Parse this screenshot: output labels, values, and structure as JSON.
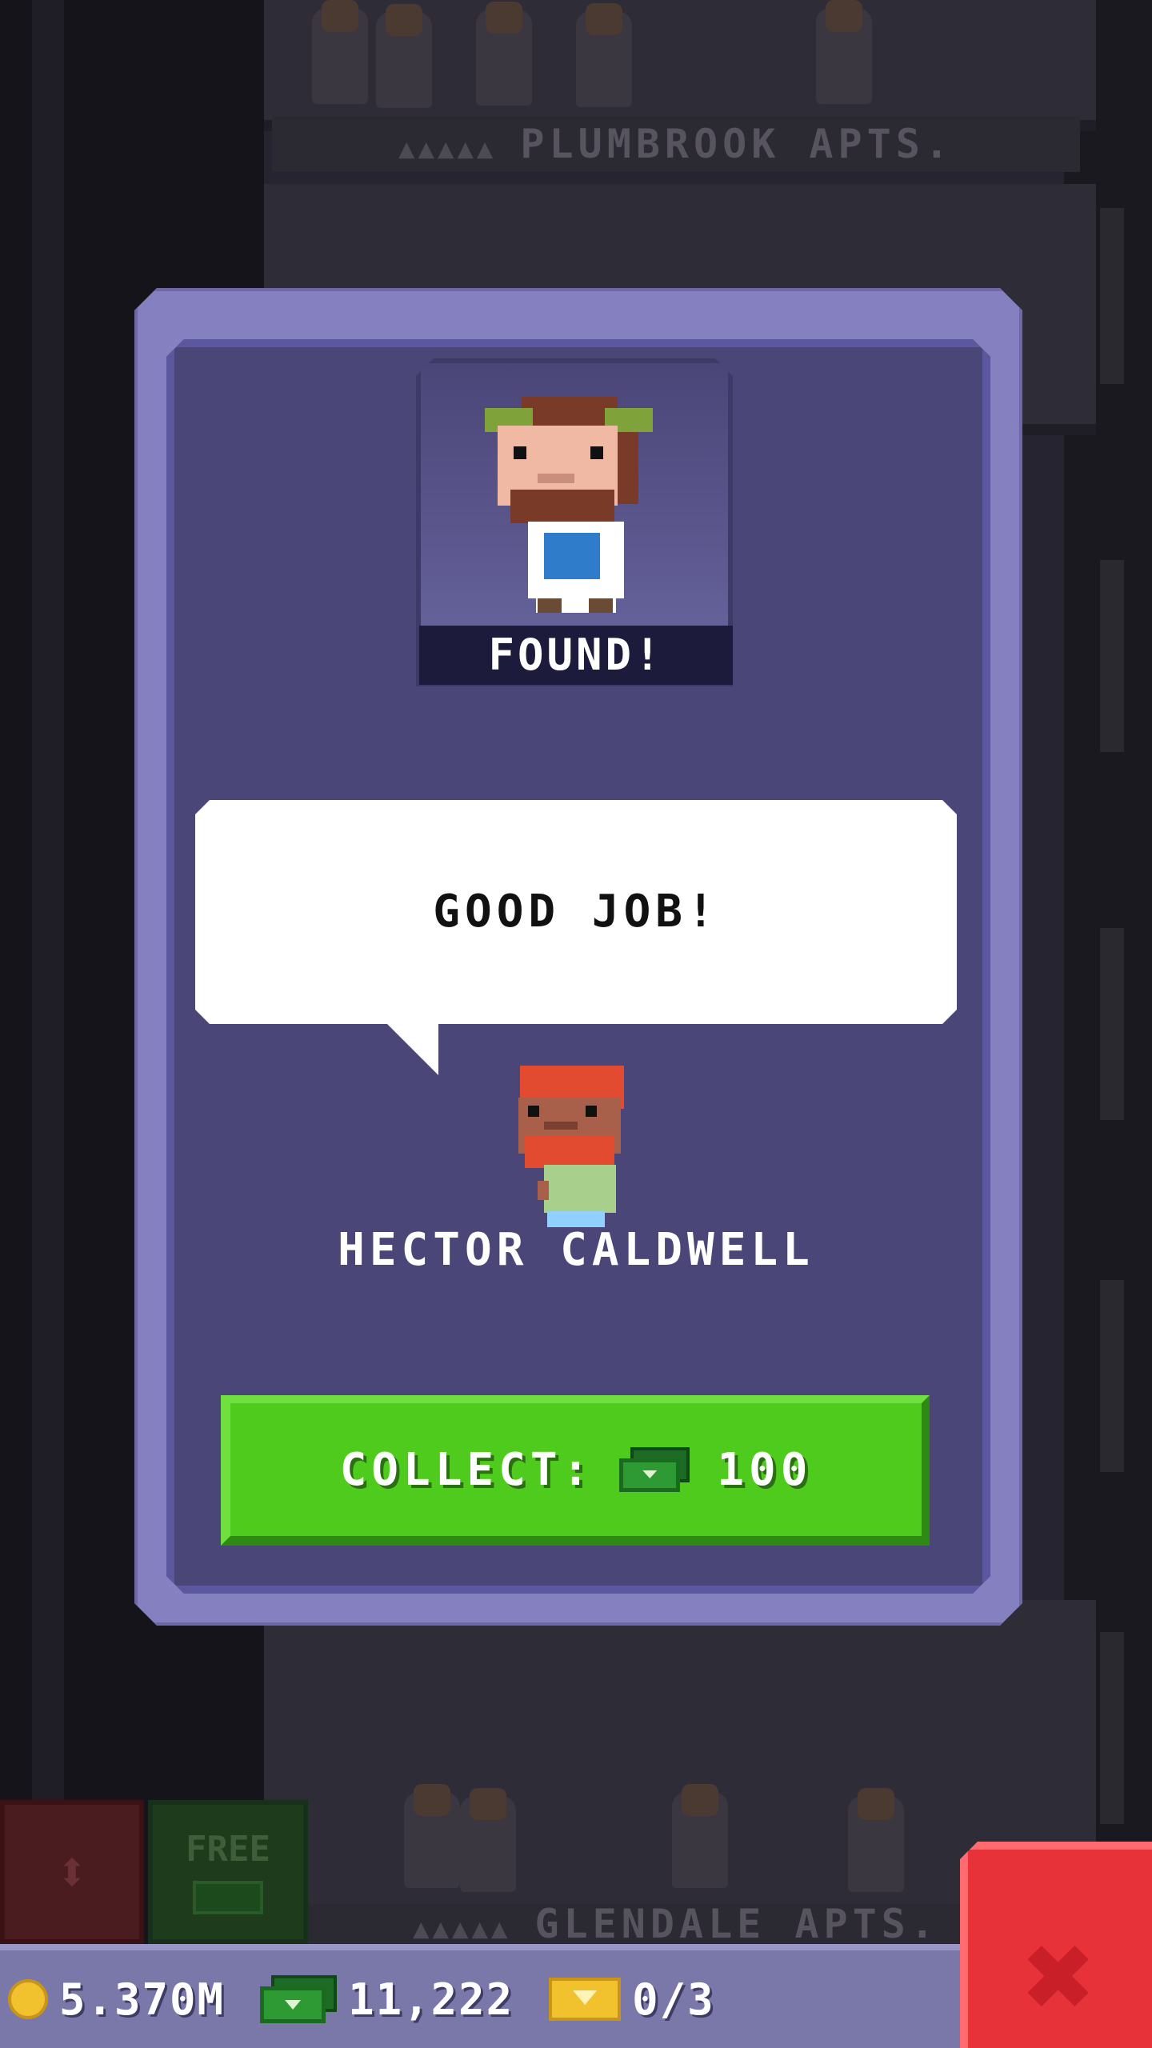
{
  "background": {
    "top_floor_label": "PLUMBROOK APTS.",
    "bottom_floor_label": "GLENDALE APTS.",
    "side_button_free": "FREE"
  },
  "modal": {
    "badge": "FOUND!",
    "speech": "GOOD JOB!",
    "name": "HECTOR CALDWELL",
    "collect_label": "COLLECT:",
    "collect_value": "100"
  },
  "status_bar": {
    "coins": "5.370M",
    "bux": "11,222",
    "tickets": "0/3"
  },
  "icons": {
    "close": "close-icon",
    "coin": "coin-icon",
    "bux": "bux-icon",
    "ticket": "ticket-icon",
    "elevator": "elevator-arrows-icon"
  },
  "colors": {
    "modal_frame": "#8580c0",
    "modal_panel": "#4a4677",
    "collect_button": "#4ecb1c",
    "close_button": "#e8323a",
    "status_bar": "#7a78a8"
  }
}
